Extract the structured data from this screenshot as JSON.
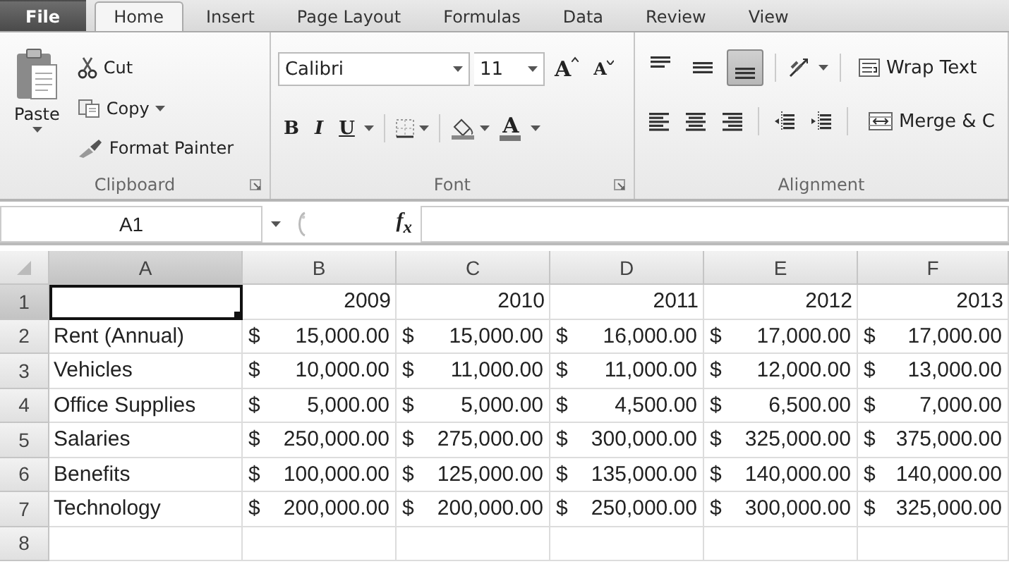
{
  "tabs": [
    {
      "label": "File",
      "kind": "file",
      "selected": false
    },
    {
      "label": "Home",
      "kind": "tab",
      "selected": true
    },
    {
      "label": "Insert",
      "kind": "tab",
      "selected": false
    },
    {
      "label": "Page Layout",
      "kind": "tab",
      "selected": false
    },
    {
      "label": "Formulas",
      "kind": "tab",
      "selected": false
    },
    {
      "label": "Data",
      "kind": "tab",
      "selected": false
    },
    {
      "label": "Review",
      "kind": "tab",
      "selected": false
    },
    {
      "label": "View",
      "kind": "tab",
      "selected": false
    }
  ],
  "clipboard": {
    "label": "Clipboard",
    "paste": "Paste",
    "cut": "Cut",
    "copy": "Copy",
    "format_painter": "Format Painter"
  },
  "font": {
    "label": "Font",
    "font_name": "Calibri",
    "font_size": "11",
    "grow": "A",
    "shrink": "A",
    "bold": "B",
    "italic": "I",
    "underline": "U",
    "font_color": "A"
  },
  "alignment": {
    "label": "Alignment",
    "vertical": [
      {
        "kind": "top",
        "selected": false
      },
      {
        "kind": "middle",
        "selected": false
      },
      {
        "kind": "bottom",
        "selected": true
      }
    ],
    "wrap_text": "Wrap Text",
    "merge": "Merge & C"
  },
  "formula_bar": {
    "name_box": "A1",
    "function_label": "f$_{x}$"
  },
  "sheet": {
    "columns": [
      {
        "label": "A",
        "selected": true
      },
      {
        "label": "B",
        "selected": false
      },
      {
        "label": "C",
        "selected": false
      },
      {
        "label": "D",
        "selected": false
      },
      {
        "label": "E",
        "selected": false
      },
      {
        "label": "F",
        "selected": false
      }
    ],
    "rows": [
      {
        "number": "1",
        "selected": true,
        "cells": [
          {
            "kind": "empty",
            "selected": true
          },
          {
            "kind": "number",
            "text": "2009",
            "selected": false
          },
          {
            "kind": "number",
            "text": "2010",
            "selected": false
          },
          {
            "kind": "number",
            "text": "2011",
            "selected": false
          },
          {
            "kind": "number",
            "text": "2012",
            "selected": false
          },
          {
            "kind": "number",
            "text": "2013",
            "selected": false
          }
        ]
      },
      {
        "number": "2",
        "selected": false,
        "cells": [
          {
            "kind": "text",
            "text": "Rent (Annual)",
            "selected": false
          },
          {
            "kind": "accounting",
            "currency": "$",
            "amount": "15,000.00",
            "selected": false
          },
          {
            "kind": "accounting",
            "currency": "$",
            "amount": "15,000.00",
            "selected": false
          },
          {
            "kind": "accounting",
            "currency": "$",
            "amount": "16,000.00",
            "selected": false
          },
          {
            "kind": "accounting",
            "currency": "$",
            "amount": "17,000.00",
            "selected": false
          },
          {
            "kind": "accounting",
            "currency": "$",
            "amount": "17,000.00",
            "selected": false
          }
        ]
      },
      {
        "number": "3",
        "selected": false,
        "cells": [
          {
            "kind": "text",
            "text": "Vehicles",
            "selected": false
          },
          {
            "kind": "accounting",
            "currency": "$",
            "amount": "10,000.00",
            "selected": false
          },
          {
            "kind": "accounting",
            "currency": "$",
            "amount": "11,000.00",
            "selected": false
          },
          {
            "kind": "accounting",
            "currency": "$",
            "amount": "11,000.00",
            "selected": false
          },
          {
            "kind": "accounting",
            "currency": "$",
            "amount": "12,000.00",
            "selected": false
          },
          {
            "kind": "accounting",
            "currency": "$",
            "amount": "13,000.00",
            "selected": false
          }
        ]
      },
      {
        "number": "4",
        "selected": false,
        "cells": [
          {
            "kind": "text",
            "text": "Office Supplies",
            "selected": false
          },
          {
            "kind": "accounting",
            "currency": "$",
            "amount": "5,000.00",
            "selected": false
          },
          {
            "kind": "accounting",
            "currency": "$",
            "amount": "5,000.00",
            "selected": false
          },
          {
            "kind": "accounting",
            "currency": "$",
            "amount": "4,500.00",
            "selected": false
          },
          {
            "kind": "accounting",
            "currency": "$",
            "amount": "6,500.00",
            "selected": false
          },
          {
            "kind": "accounting",
            "currency": "$",
            "amount": "7,000.00",
            "selected": false
          }
        ]
      },
      {
        "number": "5",
        "selected": false,
        "cells": [
          {
            "kind": "text",
            "text": "Salaries",
            "selected": false
          },
          {
            "kind": "accounting",
            "currency": "$",
            "amount": "250,000.00",
            "selected": false
          },
          {
            "kind": "accounting",
            "currency": "$",
            "amount": "275,000.00",
            "selected": false
          },
          {
            "kind": "accounting",
            "currency": "$",
            "amount": "300,000.00",
            "selected": false
          },
          {
            "kind": "accounting",
            "currency": "$",
            "amount": "325,000.00",
            "selected": false
          },
          {
            "kind": "accounting",
            "currency": "$",
            "amount": "375,000.00",
            "selected": false
          }
        ]
      },
      {
        "number": "6",
        "selected": false,
        "cells": [
          {
            "kind": "text",
            "text": "Benefits",
            "selected": false
          },
          {
            "kind": "accounting",
            "currency": "$",
            "amount": "100,000.00",
            "selected": false
          },
          {
            "kind": "accounting",
            "currency": "$",
            "amount": "125,000.00",
            "selected": false
          },
          {
            "kind": "accounting",
            "currency": "$",
            "amount": "135,000.00",
            "selected": false
          },
          {
            "kind": "accounting",
            "currency": "$",
            "amount": "140,000.00",
            "selected": false
          },
          {
            "kind": "accounting",
            "currency": "$",
            "amount": "140,000.00",
            "selected": false
          }
        ]
      },
      {
        "number": "7",
        "selected": false,
        "cells": [
          {
            "kind": "text",
            "text": "Technology",
            "selected": false
          },
          {
            "kind": "accounting",
            "currency": "$",
            "amount": "200,000.00",
            "selected": false
          },
          {
            "kind": "accounting",
            "currency": "$",
            "amount": "200,000.00",
            "selected": false
          },
          {
            "kind": "accounting",
            "currency": "$",
            "amount": "250,000.00",
            "selected": false
          },
          {
            "kind": "accounting",
            "currency": "$",
            "amount": "300,000.00",
            "selected": false
          },
          {
            "kind": "accounting",
            "currency": "$",
            "amount": "325,000.00",
            "selected": false
          }
        ]
      },
      {
        "number": "8",
        "selected": false
      }
    ]
  }
}
